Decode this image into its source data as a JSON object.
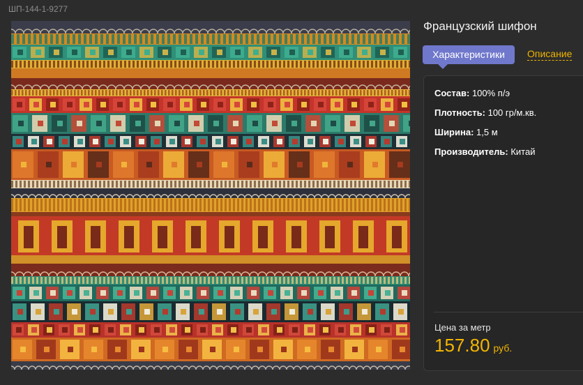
{
  "product": {
    "sku": "ШП-144-1-9277",
    "title": "Французский шифон",
    "tabs": [
      {
        "label": "Характеристики",
        "active": true
      },
      {
        "label": "Описание",
        "active": false
      }
    ],
    "specs": [
      {
        "label": "Состав:",
        "value": "100% п/э"
      },
      {
        "label": "Плотность:",
        "value": "100 гр/м.кв."
      },
      {
        "label": "Ширина:",
        "value": "1,5 м"
      },
      {
        "label": "Производитель:",
        "value": "Китай"
      }
    ],
    "price": {
      "label": "Цена за метр",
      "value": "157.80",
      "currency": "руб."
    }
  },
  "colors": {
    "background": "#2c2c2c",
    "tab_active": "#7078cc",
    "accent": "#f3b500",
    "card": "#262626"
  }
}
